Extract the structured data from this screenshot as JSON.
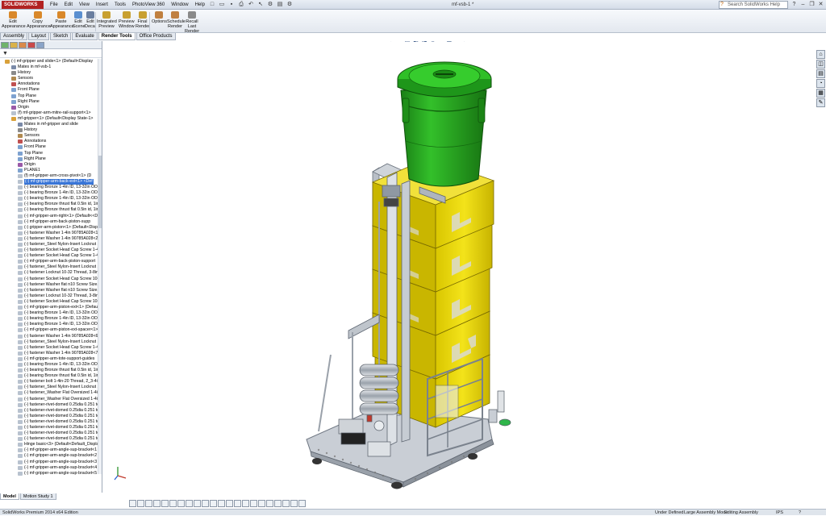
{
  "app": {
    "logo": "SOLIDWORKS",
    "document_title": "mf-vsb-1 *",
    "menus": [
      "File",
      "Edit",
      "View",
      "Insert",
      "Tools",
      "PhotoView 360",
      "Window",
      "Help"
    ],
    "help_search_placeholder": "Search SolidWorks Help"
  },
  "ribbon": {
    "buttons": [
      {
        "label": "Edit\nAppearance",
        "icon": "edit-appearance-icon",
        "color": "#d9882a"
      },
      {
        "label": "Copy\nAppearance",
        "icon": "copy-appearance-icon",
        "color": "#d9882a"
      },
      {
        "label": "Paste\nAppearance",
        "icon": "paste-appearance-icon",
        "color": "#d9882a"
      },
      {
        "label": "Edit\nScene",
        "icon": "edit-scene-icon",
        "color": "#5a8fd0"
      },
      {
        "label": "Edit\nDecal",
        "icon": "edit-decal-icon",
        "color": "#6b7fa0"
      },
      {
        "label": "Integrated\nPreview",
        "icon": "integrated-preview-icon",
        "color": "#c8a030"
      },
      {
        "label": "Preview\nWindow",
        "icon": "preview-window-icon",
        "color": "#c8a030"
      },
      {
        "label": "Final\nRender",
        "icon": "final-render-icon",
        "color": "#c8a030"
      },
      {
        "label": "Options",
        "icon": "options-icon",
        "color": "#c08040"
      },
      {
        "label": "Schedule\nRender",
        "icon": "schedule-render-icon",
        "color": "#c08040"
      },
      {
        "label": "Recall\nLast\nRender",
        "icon": "recall-last-render-icon",
        "color": "#8a8a8a"
      }
    ]
  },
  "command_tabs": [
    "Assembly",
    "Layout",
    "Sketch",
    "Evaluate",
    "Render Tools",
    "Office Products"
  ],
  "command_tabs_active": "Render Tools",
  "filter_icon": "filter-icon",
  "tree": [
    {
      "text": "(-) mf-gripper and slide<1> (Default<Display",
      "indent": 0,
      "icon": "assembly-icon"
    },
    {
      "text": "Mates in mf-vsb-1",
      "indent": 1,
      "icon": "mates-icon"
    },
    {
      "text": "History",
      "indent": 1,
      "icon": "history-icon"
    },
    {
      "text": "Sensors",
      "indent": 1,
      "icon": "sensors-icon"
    },
    {
      "text": "Annotations",
      "indent": 1,
      "icon": "annotations-icon"
    },
    {
      "text": "Front Plane",
      "indent": 1,
      "icon": "plane-icon"
    },
    {
      "text": "Top Plane",
      "indent": 1,
      "icon": "plane-icon"
    },
    {
      "text": "Right Plane",
      "indent": 1,
      "icon": "plane-icon"
    },
    {
      "text": "Origin",
      "indent": 1,
      "icon": "origin-icon"
    },
    {
      "text": "(f) mf-gripper-arm-mitre-rail-support<1>",
      "indent": 1,
      "icon": "part-icon"
    },
    {
      "text": "mf-gripper<1> (Default<Display State-1>",
      "indent": 1,
      "icon": "assembly-icon"
    },
    {
      "text": "Mates in mf-gripper and slide",
      "indent": 2,
      "icon": "mates-icon"
    },
    {
      "text": "History",
      "indent": 2,
      "icon": "history-icon"
    },
    {
      "text": "Sensors",
      "indent": 2,
      "icon": "sensors-icon"
    },
    {
      "text": "Annotations",
      "indent": 2,
      "icon": "annotations-icon"
    },
    {
      "text": "Front Plane",
      "indent": 2,
      "icon": "plane-icon"
    },
    {
      "text": "Top Plane",
      "indent": 2,
      "icon": "plane-icon"
    },
    {
      "text": "Right Plane",
      "indent": 2,
      "icon": "plane-icon"
    },
    {
      "text": "Origin",
      "indent": 2,
      "icon": "origin-icon"
    },
    {
      "text": "PLANE1",
      "indent": 2,
      "icon": "plane-icon"
    },
    {
      "text": "(f) mf-gripper-arm-cross-pivot<1> (D",
      "indent": 2,
      "icon": "part-icon"
    },
    {
      "text": "(-) mf-gripper-arm-back-ext<1> <Def",
      "indent": 2,
      "icon": "part-icon",
      "selected": true
    },
    {
      "text": "(-) bearing Bronze 1-4in ID, 13-32in OD, 1",
      "indent": 2,
      "icon": "part-icon"
    },
    {
      "text": "(-) bearing Bronze 1-4in ID, 13-32in OD, 1",
      "indent": 2,
      "icon": "part-icon"
    },
    {
      "text": "(-) bearing Bronze 1-4in ID, 13-32in OD, 1",
      "indent": 2,
      "icon": "part-icon"
    },
    {
      "text": "(-) bearing Bronze thrust flat 0.5in id, 1in",
      "indent": 2,
      "icon": "part-icon"
    },
    {
      "text": "(-) bearing Bronze thrust flat 0.5in id, 1in",
      "indent": 2,
      "icon": "part-icon"
    },
    {
      "text": "(-) mf-gripper-arm-right<1> (Default<<D",
      "indent": 2,
      "icon": "part-icon"
    },
    {
      "text": "(-) mf-gripper-arm-back-piston-supp",
      "indent": 2,
      "icon": "part-icon"
    },
    {
      "text": "(-) gripper-arm-piston<1> (Default<Disp",
      "indent": 2,
      "icon": "part-icon"
    },
    {
      "text": "(-) fastener Washer 1-4in 90785A028<1>",
      "indent": 2,
      "icon": "part-icon"
    },
    {
      "text": "(-) fastener Washer 1-4in 90785A028<2>",
      "indent": 2,
      "icon": "part-icon"
    },
    {
      "text": "(-) fastener_Steel Nylon-Insert Locknut 1",
      "indent": 2,
      "icon": "part-icon"
    },
    {
      "text": "(-) fastener Socket Head Cap Screw 1-4in",
      "indent": 2,
      "icon": "part-icon"
    },
    {
      "text": "(-) fastener Socket Head Cap Screw 1-4in",
      "indent": 2,
      "icon": "part-icon"
    },
    {
      "text": "(-) mf-gripper-arm-back-piston-support",
      "indent": 2,
      "icon": "part-icon"
    },
    {
      "text": "(-) fastener_Steel Nylon-Insert Locknut 1",
      "indent": 2,
      "icon": "part-icon"
    },
    {
      "text": "(-) fastener Locknut 10-32 Thread, 3-8in",
      "indent": 2,
      "icon": "part-icon"
    },
    {
      "text": "(-) fastener Socket Head Cap Screw 10-32",
      "indent": 2,
      "icon": "part-icon"
    },
    {
      "text": "(-) fastener Washer flat n10 Screw Size, 0.",
      "indent": 2,
      "icon": "part-icon"
    },
    {
      "text": "(-) fastener Washer flat n10 Screw Size, 0.",
      "indent": 2,
      "icon": "part-icon"
    },
    {
      "text": "(-) fastener Locknut 10-32 Thread, 3-8in",
      "indent": 2,
      "icon": "part-icon"
    },
    {
      "text": "(-) fastener Socket Head Cap Screw 10-32",
      "indent": 2,
      "icon": "part-icon"
    },
    {
      "text": "(-) mf-gripper-arm-piston-ext<1> (Defau",
      "indent": 2,
      "icon": "part-icon"
    },
    {
      "text": "(-) bearing Bronze 1-4in ID, 13-32in OD, 1",
      "indent": 2,
      "icon": "part-icon"
    },
    {
      "text": "(-) bearing Bronze 1-4in ID, 13-32in OD, 1",
      "indent": 2,
      "icon": "part-icon"
    },
    {
      "text": "(-) bearing Bronze 1-4in ID, 13-32in OD, 1",
      "indent": 2,
      "icon": "part-icon"
    },
    {
      "text": "(-) mf-gripper-arm-piston-ext-spacer<1>",
      "indent": 2,
      "icon": "part-icon"
    },
    {
      "text": "(-) fastener Washer 1-4in 90785A028<6>",
      "indent": 2,
      "icon": "part-icon"
    },
    {
      "text": "(-) fastener_Steel Nylon-Insert Locknut 1",
      "indent": 2,
      "icon": "part-icon"
    },
    {
      "text": "(-) fastener Socket Head Cap Screw 1-4in",
      "indent": 2,
      "icon": "part-icon"
    },
    {
      "text": "(-) fastener Washer 1-4in 90785A028<7>",
      "indent": 2,
      "icon": "part-icon"
    },
    {
      "text": "(-) mf-gripper-arm-tote-support-guides",
      "indent": 2,
      "icon": "part-icon"
    },
    {
      "text": "(-) bearing Bronze 1-4in ID, 13-32in OD, 1",
      "indent": 2,
      "icon": "part-icon"
    },
    {
      "text": "(-) bearing Bronze thrust flat 0.5in id, 1in",
      "indent": 2,
      "icon": "part-icon"
    },
    {
      "text": "(-) bearing Bronze thrust flat 0.5in id, 1in",
      "indent": 2,
      "icon": "part-icon"
    },
    {
      "text": "(-) fastener bolt 1-4in-20 Thread, 2_3-4in",
      "indent": 2,
      "icon": "part-icon"
    },
    {
      "text": "(-) fastener_Steel Nylon-Insert Locknut 1",
      "indent": 2,
      "icon": "part-icon"
    },
    {
      "text": "(-) fastener_Washer Flat Oversized 1-4in,",
      "indent": 2,
      "icon": "part-icon"
    },
    {
      "text": "(-) fastener_Washer Flat Oversized 1-4in,",
      "indent": 2,
      "icon": "part-icon"
    },
    {
      "text": "(-) fastener-rivet-domed 0.25dia 0.251 to",
      "indent": 2,
      "icon": "part-icon"
    },
    {
      "text": "(-) fastener-rivet-domed 0.25dia 0.251 to",
      "indent": 2,
      "icon": "part-icon"
    },
    {
      "text": "(-) fastener-rivet-domed 0.25dia 0.251 to",
      "indent": 2,
      "icon": "part-icon"
    },
    {
      "text": "(-) fastener-rivet-domed 0.25dia 0.251 to",
      "indent": 2,
      "icon": "part-icon"
    },
    {
      "text": "(-) fastener-rivet-domed 0.25dia 0.251 to",
      "indent": 2,
      "icon": "part-icon"
    },
    {
      "text": "(-) fastener-rivet-domed 0.25dia 0.251 to",
      "indent": 2,
      "icon": "part-icon"
    },
    {
      "text": "(-) fastener-rivet-domed 0.25dia 0.251 to",
      "indent": 2,
      "icon": "part-icon"
    },
    {
      "text": "Hinge basic<3> (Default<Default_Display",
      "indent": 2,
      "icon": "part-icon"
    },
    {
      "text": "(-) mf-gripper-arm-angle-sup-bracket<1",
      "indent": 2,
      "icon": "part-icon"
    },
    {
      "text": "(-) mf-gripper-arm-angle-sup-bracket<2",
      "indent": 2,
      "icon": "part-icon"
    },
    {
      "text": "(-) mf-gripper-arm-angle-sup-bracket<3",
      "indent": 2,
      "icon": "part-icon"
    },
    {
      "text": "(-) mf-gripper-arm-angle-sup-bracket<4",
      "indent": 2,
      "icon": "part-icon"
    },
    {
      "text": "(-) mf-gripper-arm-angle-sup-bracket<5",
      "indent": 2,
      "icon": "part-icon"
    }
  ],
  "view_toolbar": [
    "⌕",
    "⊕",
    "⟲",
    "▣",
    "◧",
    "◨",
    "◉",
    "✦",
    "▦",
    "◐",
    "⚙",
    "▭"
  ],
  "task_pane": [
    "⌂",
    "◫",
    "▤",
    "◔",
    "▦",
    "✎"
  ],
  "bottom_tabs": [
    "Motion Study 1"
  ],
  "bottom_tabs_left": "Model",
  "bottom_toolbar_count": 22,
  "status": {
    "edition": "SolidWorks Premium 2014 x64 Edition",
    "constraint": "Under Defined",
    "mode": "Large Assembly Mode",
    "editing": "Editing Assembly",
    "units": "IPS"
  },
  "colors": {
    "bin_green": "#24a21c",
    "tote_yellow": "#e8d800",
    "frame_gray": "#a7aeb8",
    "selection": "#3875d7"
  }
}
